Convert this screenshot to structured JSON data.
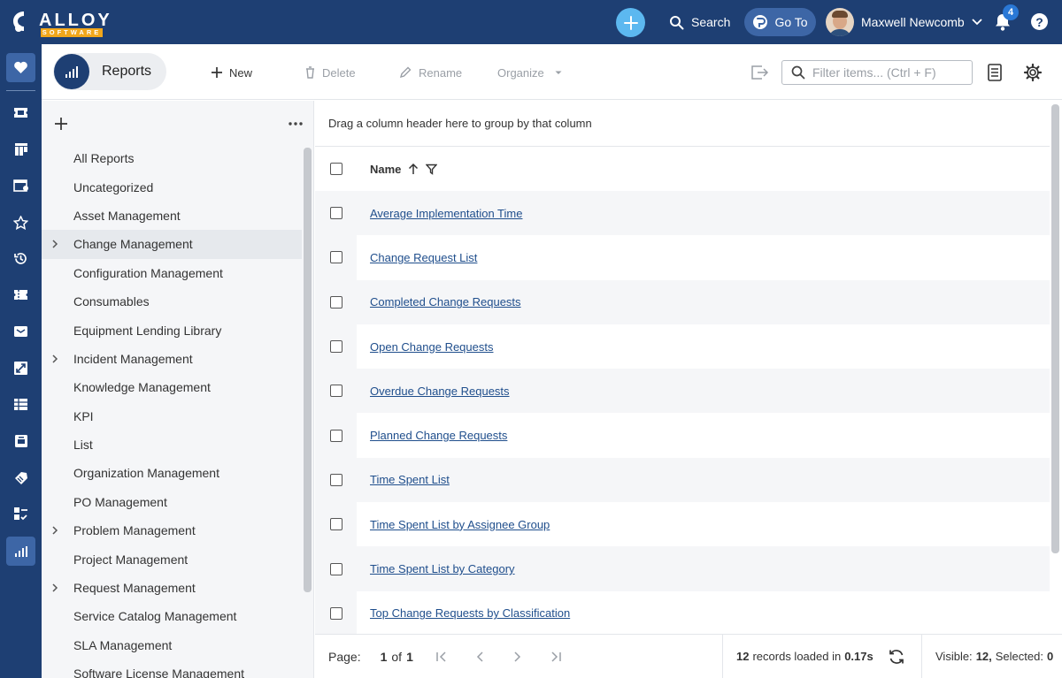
{
  "header": {
    "logo_text": "ALLOY",
    "logo_sub": "SOFTWARE",
    "search_label": "Search",
    "goto_label": "Go To",
    "user_name": "Maxwell Newcomb",
    "notification_count": "4",
    "help_glyph": "?"
  },
  "toolbar": {
    "section_title": "Reports",
    "new_label": "New",
    "delete_label": "Delete",
    "rename_label": "Rename",
    "organize_label": "Organize",
    "filter_placeholder": "Filter items... (Ctrl + F)"
  },
  "categories": [
    {
      "label": "All Reports",
      "expandable": false
    },
    {
      "label": "Uncategorized",
      "expandable": false
    },
    {
      "label": "Asset Management",
      "expandable": false
    },
    {
      "label": "Change Management",
      "expandable": true,
      "selected": true
    },
    {
      "label": "Configuration Management",
      "expandable": false
    },
    {
      "label": "Consumables",
      "expandable": false
    },
    {
      "label": "Equipment Lending Library",
      "expandable": false
    },
    {
      "label": "Incident Management",
      "expandable": true
    },
    {
      "label": "Knowledge Management",
      "expandable": false
    },
    {
      "label": "KPI",
      "expandable": false
    },
    {
      "label": "List",
      "expandable": false
    },
    {
      "label": "Organization Management",
      "expandable": false
    },
    {
      "label": "PO Management",
      "expandable": false
    },
    {
      "label": "Problem Management",
      "expandable": true
    },
    {
      "label": "Project Management",
      "expandable": false
    },
    {
      "label": "Request Management",
      "expandable": true
    },
    {
      "label": "Service Catalog Management",
      "expandable": false
    },
    {
      "label": "SLA Management",
      "expandable": false
    },
    {
      "label": "Software License Management",
      "expandable": false
    }
  ],
  "grid": {
    "group_hint": "Drag a column header here to group by that column",
    "column_name": "Name",
    "rows": [
      "Average Implementation Time",
      "Change Request List",
      "Completed Change Requests",
      "Open Change Requests",
      "Overdue Change Requests",
      "Planned Change Requests",
      "Time Spent List",
      "Time Spent List by Assignee Group",
      "Time Spent List by Category",
      "Top Change Requests by Classification"
    ]
  },
  "footer": {
    "page_label": "Page:",
    "page_current": "1",
    "page_of": "of",
    "page_total": "1",
    "records_count": "12",
    "records_text": "records loaded in",
    "records_time": "0.17s",
    "visible_label": "Visible:",
    "visible_count": "12,",
    "selected_label": "Selected:",
    "selected_count": "0"
  },
  "colors": {
    "brand_navy": "#1e3f73",
    "accent_blue": "#5cb8f0",
    "logo_orange": "#f2a71b",
    "link_blue": "#1f4e8c"
  },
  "icons": {
    "rail": [
      "heart-icon",
      "ticket-icon",
      "dashboard-icon",
      "calendar-user-icon",
      "star-icon",
      "history-icon",
      "ticket-alt-icon",
      "inbox-icon",
      "transfer-icon",
      "table-icon",
      "archive-icon",
      "tag-icon",
      "checklist-icon",
      "reports-icon"
    ]
  }
}
